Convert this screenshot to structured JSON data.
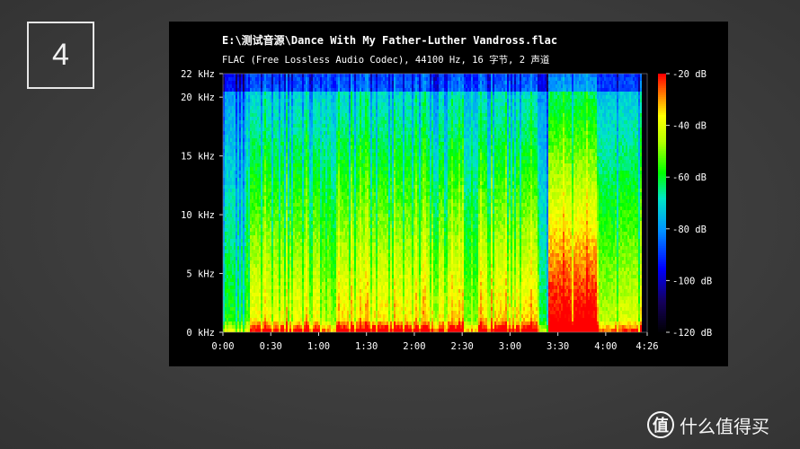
{
  "slide": {
    "number": "4"
  },
  "watermark": {
    "logo_char": "值",
    "text": "什么值得买"
  },
  "chart_data": {
    "type": "heatmap",
    "title": "E:\\测试音源\\Dance With My Father-Luther Vandross.flac",
    "subtitle": "FLAC (Free Lossless Audio Codec), 44100 Hz, 16 字节, 2 声道",
    "x_axis": {
      "range_seconds": [
        0,
        266
      ],
      "ticks": [
        {
          "value": 0,
          "label": "0:00"
        },
        {
          "value": 30,
          "label": "0:30"
        },
        {
          "value": 60,
          "label": "1:00"
        },
        {
          "value": 90,
          "label": "1:30"
        },
        {
          "value": 120,
          "label": "2:00"
        },
        {
          "value": 150,
          "label": "2:30"
        },
        {
          "value": 180,
          "label": "3:00"
        },
        {
          "value": 210,
          "label": "3:30"
        },
        {
          "value": 240,
          "label": "4:00"
        },
        {
          "value": 266,
          "label": "4:26"
        }
      ]
    },
    "y_axis": {
      "range_khz": [
        0,
        22
      ],
      "ticks": [
        {
          "value": 0,
          "label": "0 kHz"
        },
        {
          "value": 5,
          "label": "5 kHz"
        },
        {
          "value": 10,
          "label": "10 kHz"
        },
        {
          "value": 15,
          "label": "15 kHz"
        },
        {
          "value": 20,
          "label": "20 kHz"
        },
        {
          "value": 22,
          "label": "22 kHz"
        }
      ]
    },
    "colorbar": {
      "range_db": [
        -120,
        -20
      ],
      "ticks": [
        {
          "value": -20,
          "label": "-20 dB"
        },
        {
          "value": -40,
          "label": "-40 dB"
        },
        {
          "value": -60,
          "label": "-60 dB"
        },
        {
          "value": -80,
          "label": "-80 dB"
        },
        {
          "value": -100,
          "label": "-100 dB"
        },
        {
          "value": -120,
          "label": "-120 dB"
        }
      ]
    },
    "content_end_seconds": 262,
    "intensity_sections": [
      {
        "start": 0,
        "end": 16,
        "level": 0.3
      },
      {
        "start": 16,
        "end": 60,
        "level": 0.55
      },
      {
        "start": 60,
        "end": 70,
        "level": 0.38
      },
      {
        "start": 70,
        "end": 150,
        "level": 0.58
      },
      {
        "start": 150,
        "end": 160,
        "level": 0.38
      },
      {
        "start": 160,
        "end": 198,
        "level": 0.6
      },
      {
        "start": 198,
        "end": 203,
        "level": 0.25
      },
      {
        "start": 203,
        "end": 235,
        "level": 0.8
      },
      {
        "start": 235,
        "end": 245,
        "level": 0.45
      },
      {
        "start": 245,
        "end": 262,
        "level": 0.5
      }
    ],
    "colors": {
      "bg": "#000000",
      "text": "#ffffff",
      "panel_edge": "#dddddd"
    }
  }
}
